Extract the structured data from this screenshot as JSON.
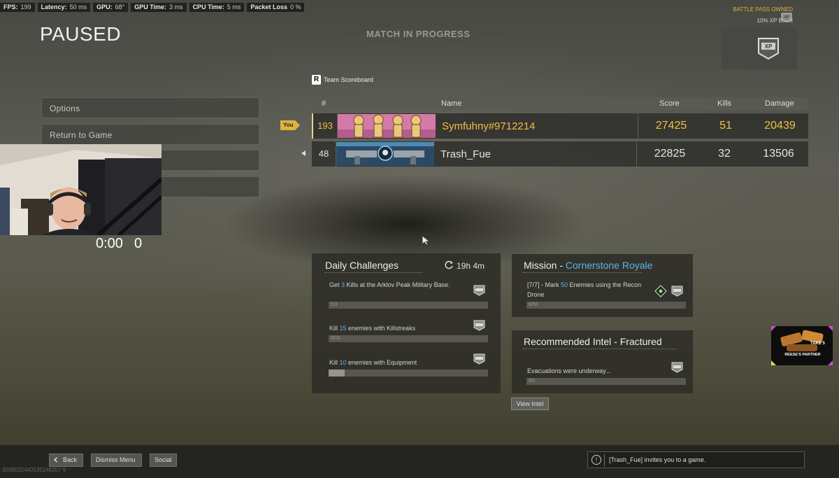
{
  "perf": {
    "fps_label": "FPS:",
    "fps_value": "199",
    "latency_label": "Latency:",
    "latency_value": "50 ms",
    "gpu_label": "GPU:",
    "gpu_value": "68°",
    "gpu_time_label": "GPU Time:",
    "gpu_time_value": "3 ms",
    "cpu_time_label": "CPU Time:",
    "cpu_time_value": "5 ms",
    "packet_loss_label": "Packet Loss",
    "packet_loss_value": "0 %"
  },
  "battle_pass": {
    "owned": "BATTLE PASS OWNED",
    "boost": "10% XP Boost"
  },
  "header": {
    "paused": "PAUSED",
    "match_status": "MATCH IN PROGRESS"
  },
  "menu": {
    "items": [
      "Options",
      "Return to Game"
    ]
  },
  "stream": {
    "timer": "0:00",
    "count": "0"
  },
  "scoreboard": {
    "key": "R",
    "team_label": "Team Scoreboard",
    "columns": {
      "rank": "#",
      "name": "Name",
      "score": "Score",
      "kills": "Kills",
      "damage": "Damage"
    },
    "you_tag": "You",
    "rows": [
      {
        "rank": "193",
        "name": "Symfuhny#9712214",
        "score": "27425",
        "kills": "51",
        "damage": "20439"
      },
      {
        "rank": "48",
        "name": "Trash_Fue",
        "score": "22825",
        "kills": "32",
        "damage": "13506"
      }
    ]
  },
  "daily": {
    "title": "Daily Challenges",
    "timer": "19h 4m",
    "challenges": [
      {
        "pre": "Get ",
        "num": "3",
        "post": " Kills at the Arklov Peak Military Base.",
        "progress_text": "0/3",
        "progress": 0
      },
      {
        "pre": "Kill ",
        "num": "15",
        "post": " enemies with Killstreaks",
        "progress_text": "0/15",
        "progress": 0
      },
      {
        "pre": "Kill ",
        "num": "10",
        "post": " enemies with Equipment",
        "progress_text": "1/10",
        "progress": 0.1
      }
    ]
  },
  "mission": {
    "title_prefix": "Mission - ",
    "title_name": "Cornerstone Royale",
    "pre": "[7/7] - Mark ",
    "num": "50",
    "post": " Enemies using the Recon Drone",
    "progress_text": "0/50",
    "progress": 0
  },
  "intel": {
    "title": "Recommended Intel - Fractured",
    "text": "Evacuations were underway...",
    "progress_text": "0/1",
    "progress": 0,
    "button": "View Intel"
  },
  "bottom": {
    "back": "Back",
    "dismiss": "Dismiss Menu",
    "social": "Social",
    "footer_id": "3038032440535248357 9",
    "notification": "[Trash_Fue] invites you to a game."
  },
  "partner": {
    "line1": "TAKE 5",
    "line2": "REESE'S PARTNER"
  },
  "colors": {
    "gold": "#f0c040",
    "blue": "#5fb3e8"
  }
}
